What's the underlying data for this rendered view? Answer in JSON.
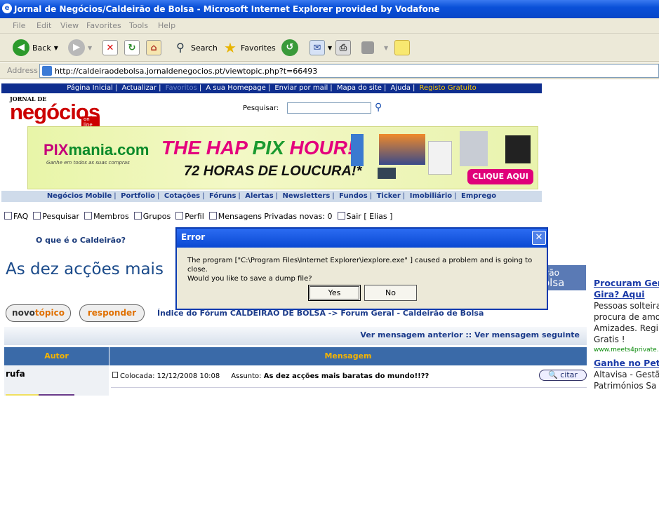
{
  "window": {
    "title": "Jornal de Negócios/Caldeirão de Bolsa - Microsoft Internet Explorer provided by Vodafone"
  },
  "menu": [
    "File",
    "Edit",
    "View",
    "Favorites",
    "Tools",
    "Help"
  ],
  "toolbar": {
    "back": "Back",
    "search": "Search",
    "favorites": "Favorites"
  },
  "address": {
    "label": "Address",
    "url": "http://caldeiraodebolsa.jornaldenegocios.pt/viewtopic.php?t=66493"
  },
  "topnav": [
    "Página Inicial",
    "Actualizar",
    "Favoritos",
    "A sua Homepage",
    "Enviar por mail",
    "Mapa do site",
    "Ajuda",
    "Registo Gratuito"
  ],
  "logo": {
    "top": "JORNAL DE",
    "main": "negócios",
    "sub": "on line"
  },
  "site_search": {
    "label": "Pesquisar:"
  },
  "banner": {
    "brand_a": "PIX",
    "brand_b": "mania.com",
    "tagline": "Ganhe em todos as suas compras",
    "headline_a": "THE HAP ",
    "headline_b": "PIX",
    "headline_c": " HOUR!",
    "subline": "72 HORAS DE LOUCURA!*",
    "cta": "CLIQUE AQUI"
  },
  "secnav": [
    "Negócios Mobile",
    "Portfolio",
    "Cotações",
    "Fóruns",
    "Alertas",
    "Newsletters",
    "Fundos",
    "Ticker",
    "Imobiliário",
    "Emprego"
  ],
  "forumnav": {
    "faq": "FAQ",
    "search": "Pesquisar",
    "members": "Membros",
    "groups": "Grupos",
    "profile": "Perfil",
    "pm": "Mensagens Privadas novas: 0",
    "logout": "Sair [ Elias ]"
  },
  "oque": "O que é o Caldeirão?",
  "page_title": "As dez acções mais",
  "cald_small": [
    "irão",
    "olsa"
  ],
  "buttons": {
    "novo_a": "novo",
    "novo_b": "tópico",
    "responder": "responder"
  },
  "breadcrumb": "Índice do Fórum CALDEIRÃO DE BOLSA -> Forum Geral - Caldeirão de Bolsa",
  "prevnext": "Ver mensagem anterior :: Ver mensagem seguinte",
  "table": {
    "author_header": "Autor",
    "message_header": "Mensagem"
  },
  "post": {
    "author": "rufa",
    "posted": "Colocada: 12/12/2008 10:08",
    "subject_label": "Assunto:",
    "subject": "As dez acções mais baratas do mundo!!??",
    "quote": "citar"
  },
  "ads": [
    {
      "title": "Procuram Ger",
      "title2": "Gira? Aqui",
      "text": [
        "Pessoas solteira",
        "procura de amor",
        "Amizades. Regi",
        "Gratis !"
      ],
      "url": "www.meets4private."
    },
    {
      "title": "Ganhe no Pet",
      "text": [
        "Altavisa - Gestã",
        "Patrimónios Sa"
      ]
    }
  ],
  "dialog": {
    "title": "Error",
    "message": "The program [\"C:\\Program Files\\Internet Explorer\\iexplore.exe\" ] caused a problem and is going to close.\nWould you like to save a dump file?",
    "yes": "Yes",
    "no": "No"
  }
}
